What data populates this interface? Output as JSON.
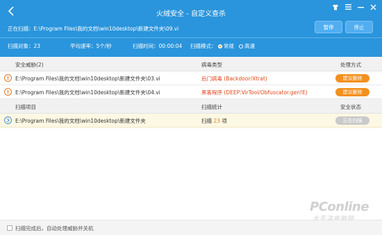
{
  "header": {
    "title": "火绒安全 - 自定义查杀",
    "scanning_label": "正在扫描：",
    "scanning_path": "E:\\Program Files\\我的文档\\win10desktop\\新建文件夹\\09.vi",
    "pause_label": "暂停",
    "stop_label": "停止",
    "stats": {
      "objects_label": "扫描对象：",
      "objects_value": "23",
      "speed_label": "平均速率：",
      "speed_value": "5个/秒",
      "time_label": "扫描时间：",
      "time_value": "00:00:04",
      "mode_label": "扫描模式：",
      "mode_normal": "常规",
      "mode_fast": "高速"
    },
    "icons": [
      "back-icon",
      "shirt-icon",
      "menu-icon",
      "minimize-icon",
      "close-icon"
    ]
  },
  "threats": {
    "headers": {
      "threat": "安全威胁(2)",
      "type": "病毒类型",
      "action": "处理方式"
    },
    "rows": [
      {
        "path": "E:\\Program Files\\我的文档\\win10desktop\\新建文件夹\\03.vi",
        "type": "后门病毒 (Backdoor/Xtrat)",
        "action": "建议删除"
      },
      {
        "path": "E:\\Program Files\\我的文档\\win10desktop\\新建文件夹\\04.vi",
        "type": "黑客程序 (DEEP:VirTool/Obfuscator.gen!E)",
        "action": "建议删除"
      }
    ]
  },
  "scan_items": {
    "headers": {
      "item": "扫描项目",
      "stats": "扫描统计",
      "status": "安全状态"
    },
    "rows": [
      {
        "path": "E:\\Program Files\\我的文档\\win10desktop\\新建文件夹",
        "stats_prefix": "扫描",
        "stats_count": "23",
        "stats_suffix": "项",
        "status": "正在扫描"
      }
    ]
  },
  "watermark": {
    "main": "PConline",
    "sub": "太平洋电脑网"
  },
  "footer": {
    "shutdown_label": "扫描完成后，自动处理威胁并关机"
  },
  "colors": {
    "header_bg": "#2a95dc",
    "warning_orange": "#f3901f",
    "threat_red": "#e0461c",
    "scanning_row_bg": "#fdf8e3"
  }
}
